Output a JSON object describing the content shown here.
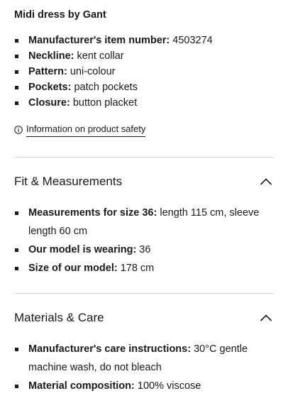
{
  "product_title": "Midi dress by Gant",
  "details": [
    {
      "label": "Manufacturer's item number:",
      "value": " 4503274"
    },
    {
      "label": "Neckline:",
      "value": " kent collar"
    },
    {
      "label": "Pattern:",
      "value": " uni-colour"
    },
    {
      "label": "Pockets:",
      "value": " patch pockets"
    },
    {
      "label": "Closure:",
      "value": " button placket"
    }
  ],
  "safety_link": "Information on product safety",
  "sections": [
    {
      "title": "Fit & Measurements",
      "expanded": true,
      "items": [
        {
          "label": "Measurements for size 36:",
          "value": " length 115 cm, sleeve length 60 cm"
        },
        {
          "label": "Our model is wearing:",
          "value": " 36"
        },
        {
          "label": "Size of our model:",
          "value": " 178 cm"
        }
      ]
    },
    {
      "title": "Materials & Care",
      "expanded": true,
      "items": [
        {
          "label": "Manufacturer's care instructions:",
          "value": " 30°C gentle machine wash, do not bleach"
        },
        {
          "label": "Material composition:",
          "value": " 100% viscose"
        }
      ]
    }
  ],
  "icons": {
    "safety": "info-circle-icon",
    "section_toggle": "chevron-up-icon"
  }
}
